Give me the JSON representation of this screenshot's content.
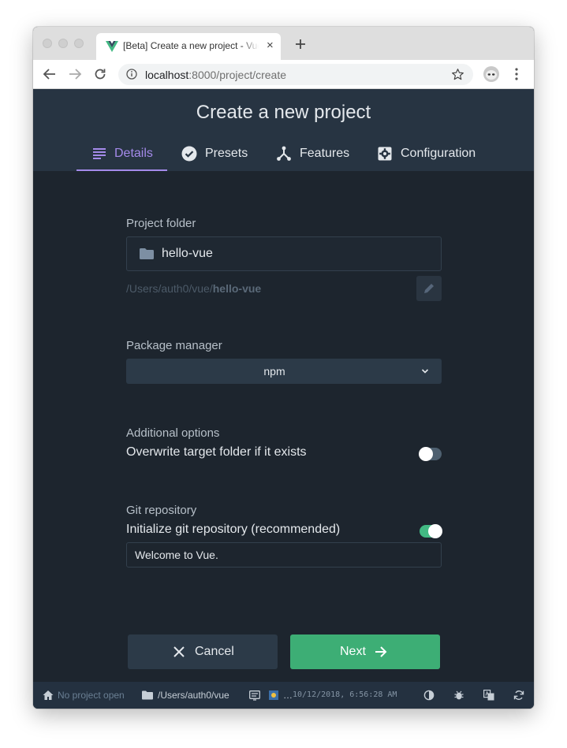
{
  "browser": {
    "tab_title": "[Beta] Create a new project - Vue CLI",
    "tab_close": "×",
    "url_host": "localhost",
    "url_rest": ":8000/project/create"
  },
  "page": {
    "title": "Create a new project",
    "tabs": [
      {
        "label": "Details",
        "icon": "list-icon",
        "active": true
      },
      {
        "label": "Presets",
        "icon": "check-circle-icon",
        "active": false
      },
      {
        "label": "Features",
        "icon": "fork-icon",
        "active": false
      },
      {
        "label": "Configuration",
        "icon": "gear-icon",
        "active": false
      }
    ]
  },
  "form": {
    "project_folder_label": "Project folder",
    "project_folder_value": "hello-vue",
    "folder_path_prefix": "/Users/auth0/vue/",
    "folder_path_name": "hello-vue",
    "package_manager_label": "Package manager",
    "package_manager_value": "npm",
    "additional_options_label": "Additional options",
    "overwrite_label": "Overwrite target folder if it exists",
    "overwrite_enabled": false,
    "git_label": "Git repository",
    "git_init_label": "Initialize git repository (recommended)",
    "git_init_enabled": true,
    "git_message_value": "Welcome to Vue."
  },
  "actions": {
    "cancel_label": "Cancel",
    "next_label": "Next"
  },
  "statusbar": {
    "project": "No project open",
    "cwd": "/Users/auth0/vue",
    "log_ellipsis": "…",
    "timestamp": "10/12/2018, 6:56:28 AM"
  },
  "colors": {
    "accent": "#a48aea",
    "primary": "#3dae75",
    "background": "#1d252e",
    "header": "#273442"
  }
}
